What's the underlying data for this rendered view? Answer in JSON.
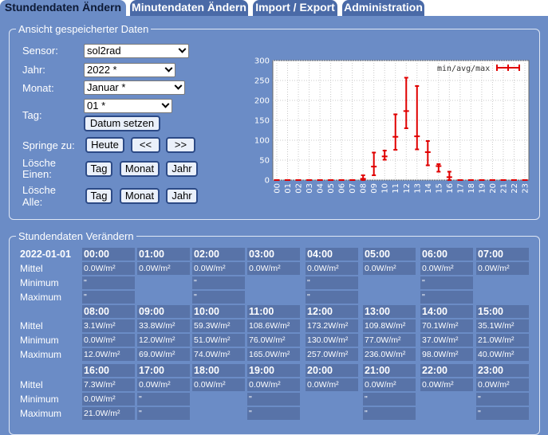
{
  "tabs": [
    {
      "label": "Stundendaten Ändern",
      "active": true
    },
    {
      "label": "Minutendaten Ändern",
      "active": false
    },
    {
      "label": "Import / Export",
      "active": false
    },
    {
      "label": "Administration",
      "active": false
    }
  ],
  "view": {
    "legend": "Ansicht gespeicherter Daten",
    "sensor_label": "Sensor:",
    "sensor_value": "sol2rad",
    "year_label": "Jahr:",
    "year_value": "2022 *",
    "month_label": "Monat:",
    "month_value": "Januar *",
    "day_label": "Tag:",
    "day_value": "01 *",
    "set_date_button": "Datum setzen",
    "jump_label": "Springe zu:",
    "today_button": "Heute",
    "prev_button": "<<",
    "next_button": ">>",
    "delete_one_label_1": "Lösche",
    "delete_one_label_2": "Einen:",
    "delete_all_label_1": "Lösche",
    "delete_all_label_2": "Alle:",
    "day_button": "Tag",
    "month_button": "Monat",
    "year_button": "Jahr"
  },
  "chart_data": {
    "type": "line",
    "legend": "min/avg/max",
    "legend_position": "top-right",
    "series_color": "#e00000",
    "ylim": [
      0,
      300
    ],
    "yticks": [
      "0",
      "50",
      "100",
      "150",
      "200",
      "250",
      "300"
    ],
    "categories": [
      "00",
      "01",
      "02",
      "03",
      "04",
      "05",
      "06",
      "07",
      "08",
      "09",
      "10",
      "11",
      "12",
      "13",
      "14",
      "15",
      "16",
      "17",
      "18",
      "19",
      "20",
      "21",
      "22",
      "23"
    ],
    "min": [
      0,
      0,
      0,
      0,
      0,
      0,
      0,
      0,
      0,
      12,
      51,
      76,
      130,
      77,
      37,
      21,
      0,
      0,
      0,
      0,
      0,
      0,
      0,
      0
    ],
    "avg": [
      0,
      0,
      0,
      0,
      0,
      0,
      0,
      0,
      3.1,
      33.8,
      59.3,
      108.6,
      173.2,
      109.8,
      70.1,
      35.1,
      7.3,
      0,
      0,
      0,
      0,
      0,
      0,
      0
    ],
    "max": [
      0,
      0,
      0,
      0,
      0,
      0,
      0,
      0,
      12,
      69,
      74,
      165,
      257,
      236,
      98,
      40,
      21,
      0,
      0,
      0,
      0,
      0,
      0,
      0
    ],
    "grid": true
  },
  "hourly": {
    "legend": "Stundendaten Verändern",
    "date": "2022-01-01",
    "row_labels": [
      "Mittel",
      "Minimum",
      "Maximum"
    ],
    "blocks": [
      {
        "hours": [
          "00:00",
          "01:00",
          "02:00",
          "03:00",
          "04:00",
          "05:00",
          "06:00",
          "07:00"
        ],
        "mittel": [
          "0.0W/m²",
          "0.0W/m²",
          "0.0W/m²",
          "0.0W/m²",
          "0.0W/m²",
          "0.0W/m²",
          "0.0W/m²",
          "0.0W/m²"
        ],
        "minimum": [
          "\"",
          "",
          "\"",
          "",
          "\"",
          "",
          "\"",
          ""
        ],
        "maximum": [
          "\"",
          "",
          "\"",
          "",
          "\"",
          "",
          "\"",
          ""
        ]
      },
      {
        "hours": [
          "08:00",
          "09:00",
          "10:00",
          "11:00",
          "12:00",
          "13:00",
          "14:00",
          "15:00"
        ],
        "mittel": [
          "3.1W/m²",
          "33.8W/m²",
          "59.3W/m²",
          "108.6W/m²",
          "173.2W/m²",
          "109.8W/m²",
          "70.1W/m²",
          "35.1W/m²"
        ],
        "minimum": [
          "0.0W/m²",
          "12.0W/m²",
          "51.0W/m²",
          "76.0W/m²",
          "130.0W/m²",
          "77.0W/m²",
          "37.0W/m²",
          "21.0W/m²"
        ],
        "maximum": [
          "12.0W/m²",
          "69.0W/m²",
          "74.0W/m²",
          "165.0W/m²",
          "257.0W/m²",
          "236.0W/m²",
          "98.0W/m²",
          "40.0W/m²"
        ]
      },
      {
        "hours": [
          "16:00",
          "17:00",
          "18:00",
          "19:00",
          "20:00",
          "21:00",
          "22:00",
          "23:00"
        ],
        "mittel": [
          "7.3W/m²",
          "0.0W/m²",
          "0.0W/m²",
          "0.0W/m²",
          "0.0W/m²",
          "0.0W/m²",
          "0.0W/m²",
          "0.0W/m²"
        ],
        "minimum": [
          "0.0W/m²",
          "\"",
          "",
          "\"",
          "",
          "\"",
          "",
          "\""
        ],
        "maximum": [
          "21.0W/m²",
          "\"",
          "",
          "\"",
          "",
          "\"",
          "",
          "\""
        ]
      }
    ]
  }
}
